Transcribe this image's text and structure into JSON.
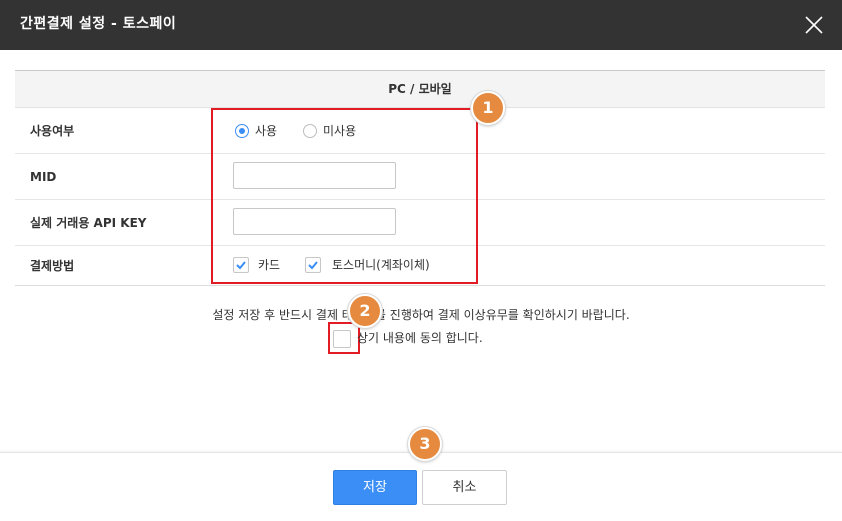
{
  "dialog": {
    "title": "간편결제 설정 - 토스페이"
  },
  "table": {
    "header": "PC / 모바일",
    "rows": [
      {
        "label": "사용여부",
        "options": [
          {
            "label": "사용",
            "selected": true
          },
          {
            "label": "미사용",
            "selected": false
          }
        ]
      },
      {
        "label": "MID",
        "value": ""
      },
      {
        "label": "실제 거래용 API KEY",
        "value": ""
      },
      {
        "label": "결제방법",
        "options": [
          {
            "label": "카드",
            "checked": true
          },
          {
            "label": "토스머니(계좌이체)",
            "checked": true
          }
        ]
      }
    ]
  },
  "notice": "설정 저장 후 반드시 결제 테스트를 진행하여 결제 이상유무를 확인하시기 바랍니다.",
  "agree": {
    "label": "상기 내용에 동의 합니다.",
    "checked": false
  },
  "buttons": {
    "save": "저장",
    "cancel": "취소"
  },
  "badges": [
    "1",
    "2",
    "3"
  ],
  "colors": {
    "title_bar": "#333333",
    "primary": "#3a8ef6",
    "highlight": "#e21c25",
    "badge": "#e58a3e"
  },
  "icons": {
    "close": "close-icon",
    "check": "check-icon"
  }
}
